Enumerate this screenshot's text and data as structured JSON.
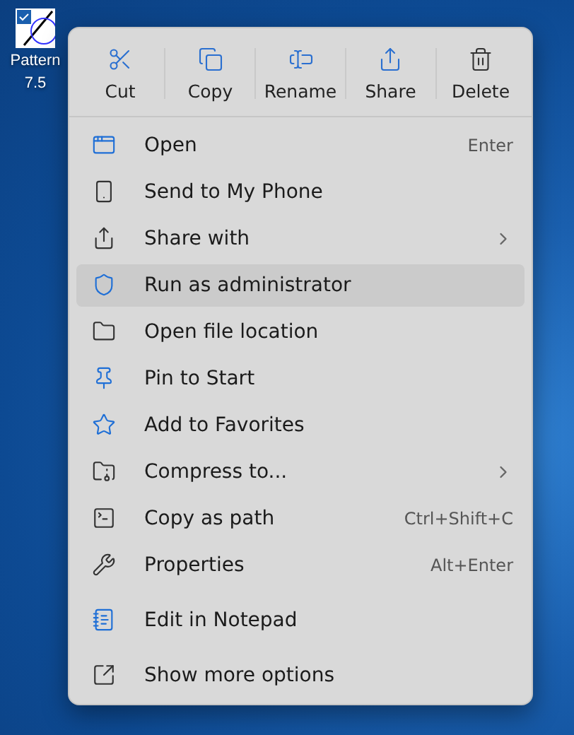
{
  "desktop_icon": {
    "label_lines": [
      "Pattern",
      "7.5"
    ]
  },
  "menu": {
    "toolbar": [
      {
        "label": "Cut"
      },
      {
        "label": "Copy"
      },
      {
        "label": "Rename"
      },
      {
        "label": "Share"
      },
      {
        "label": "Delete"
      }
    ],
    "groups": [
      [
        {
          "label": "Open",
          "shortcut": "Enter",
          "submenu": false,
          "selected": false
        },
        {
          "label": "Send to My Phone",
          "submenu": false,
          "selected": false
        },
        {
          "label": "Share with",
          "submenu": true,
          "selected": false
        },
        {
          "label": "Run as administrator",
          "submenu": false,
          "selected": true
        },
        {
          "label": "Open file location",
          "submenu": false,
          "selected": false
        },
        {
          "label": "Pin to Start",
          "submenu": false,
          "selected": false
        },
        {
          "label": "Add to Favorites",
          "submenu": false,
          "selected": false
        },
        {
          "label": "Compress to...",
          "submenu": true,
          "selected": false
        },
        {
          "label": "Copy as path",
          "shortcut": "Ctrl+Shift+C",
          "submenu": false,
          "selected": false
        },
        {
          "label": "Properties",
          "shortcut": "Alt+Enter",
          "submenu": false,
          "selected": false
        }
      ],
      [
        {
          "label": "Edit in Notepad",
          "submenu": false,
          "selected": false
        }
      ],
      [
        {
          "label": "Show more options",
          "submenu": false,
          "selected": false
        }
      ]
    ]
  }
}
